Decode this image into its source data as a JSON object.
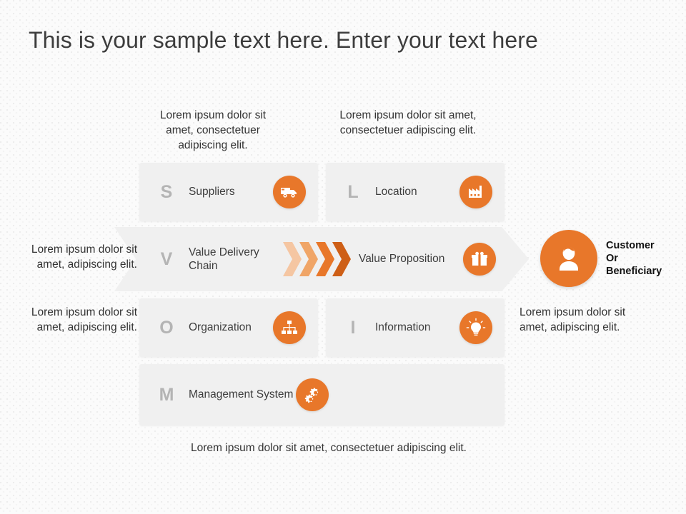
{
  "title": "This is your sample text here. Enter your text here",
  "captions": {
    "top_left": "Lorem ipsum dolor sit amet, consectetuer adipiscing elit.",
    "top_right": "Lorem ipsum dolor sit amet, consectetuer adipiscing elit.",
    "left_middle": "Lorem ipsum dolor sit amet, adipiscing elit.",
    "left_lower": "Lorem ipsum dolor sit amet, adipiscing elit.",
    "right_lower": "Lorem ipsum dolor sit amet, adipiscing elit.",
    "bottom": "Lorem ipsum dolor sit amet, consectetuer adipiscing elit."
  },
  "rows": {
    "suppliers": {
      "letter": "S",
      "label": "Suppliers",
      "icon": "truck-icon"
    },
    "location": {
      "letter": "L",
      "label": "Location",
      "icon": "factory-icon"
    },
    "value_delivery_chain": {
      "letter": "V",
      "label": "Value Delivery Chain"
    },
    "value_proposition": {
      "label": "Value Proposition",
      "icon": "gift-icon"
    },
    "organization": {
      "letter": "O",
      "label": "Organization",
      "icon": "org-chart-icon"
    },
    "information": {
      "letter": "I",
      "label": "Information",
      "icon": "lightbulb-icon"
    },
    "management_system": {
      "letter": "M",
      "label": "Management System",
      "icon": "gears-icon"
    }
  },
  "customer": {
    "line1": "Customer",
    "line2": "Or",
    "line3": "Beneficiary",
    "icon": "person-icon"
  },
  "colors": {
    "accent": "#E8772A",
    "chevron_1": "#F5C6A2",
    "chevron_2": "#F0A567",
    "chevron_3": "#E8772A",
    "chevron_4": "#CE5F17",
    "box_bg": "#F0F0F0",
    "letter_gray": "#B4B4B4",
    "text_dark": "#3D3D3D"
  }
}
